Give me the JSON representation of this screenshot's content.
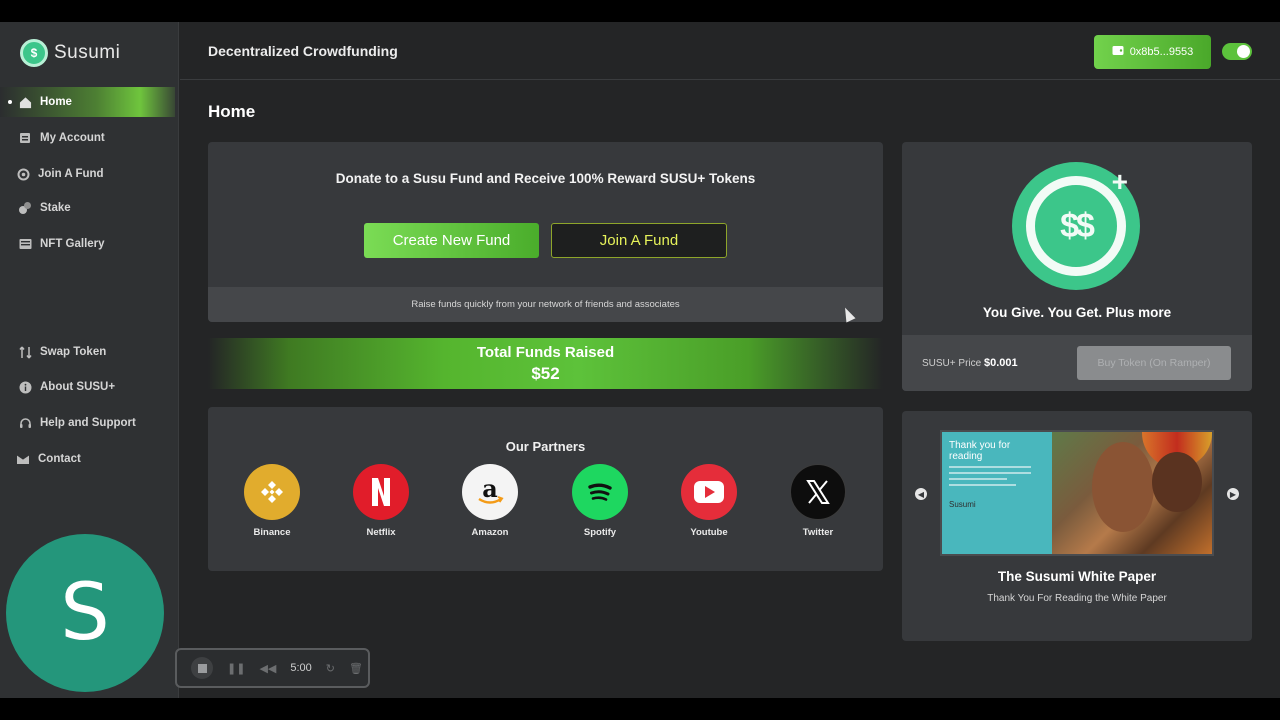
{
  "brand": {
    "name": "Susumi",
    "logo_icon": "susumi-coin-icon"
  },
  "header": {
    "title": "Decentralized Crowdfunding",
    "wallet_address": "0x8b5...9553",
    "wallet_icon": "wallet-icon",
    "theme_toggle_on": true
  },
  "sidebar": {
    "items": [
      {
        "label": "Home",
        "icon": "home-icon",
        "active": true
      },
      {
        "label": "My Account",
        "icon": "account-icon"
      },
      {
        "label": "Join A Fund",
        "icon": "join-fund-icon"
      },
      {
        "label": "Stake",
        "icon": "stake-icon"
      },
      {
        "label": "NFT Gallery",
        "icon": "gallery-icon"
      }
    ],
    "lower_items": [
      {
        "label": "Swap Token",
        "icon": "swap-icon"
      },
      {
        "label": "About SUSU+",
        "icon": "info-icon"
      },
      {
        "label": "Help and Support",
        "icon": "headset-icon"
      },
      {
        "label": "Contact",
        "icon": "contact-icon"
      }
    ],
    "avatar_letter": "S"
  },
  "page": {
    "title": "Home"
  },
  "donate": {
    "heading": "Donate to a Susu Fund and Receive 100% Reward SUSU+ Tokens",
    "create_label": "Create New Fund",
    "join_label": "Join A Fund",
    "footer_text": "Raise funds quickly from your network of friends and associates"
  },
  "total": {
    "label": "Total Funds Raised",
    "value": "$52"
  },
  "partners": {
    "title": "Our Partners",
    "items": [
      {
        "name": "Binance",
        "color": "#f0b90b"
      },
      {
        "name": "Netflix",
        "color": "#e50914"
      },
      {
        "name": "Amazon",
        "color": "#ffffff"
      },
      {
        "name": "Spotify",
        "color": "#1ed760"
      },
      {
        "name": "Youtube",
        "color": "#ff0000"
      },
      {
        "name": "Twitter",
        "color": "#000000"
      }
    ]
  },
  "token": {
    "tagline": "You Give. You Get. Plus more",
    "price_label": "SUSU+ Price",
    "price_value": "$0.001",
    "buy_label": "Buy Token (On Ramper)"
  },
  "whitepaper": {
    "thumb_title": "Thank you for reading",
    "thumb_logo": "Susumi",
    "title": "The Susumi White Paper",
    "subtitle": "Thank You For Reading the White Paper"
  },
  "recorder": {
    "time": "5:00"
  },
  "colors": {
    "accent_green": "#5cc23c",
    "brand_teal": "#3cc68a",
    "bg": "#242526",
    "card": "#37393c"
  }
}
